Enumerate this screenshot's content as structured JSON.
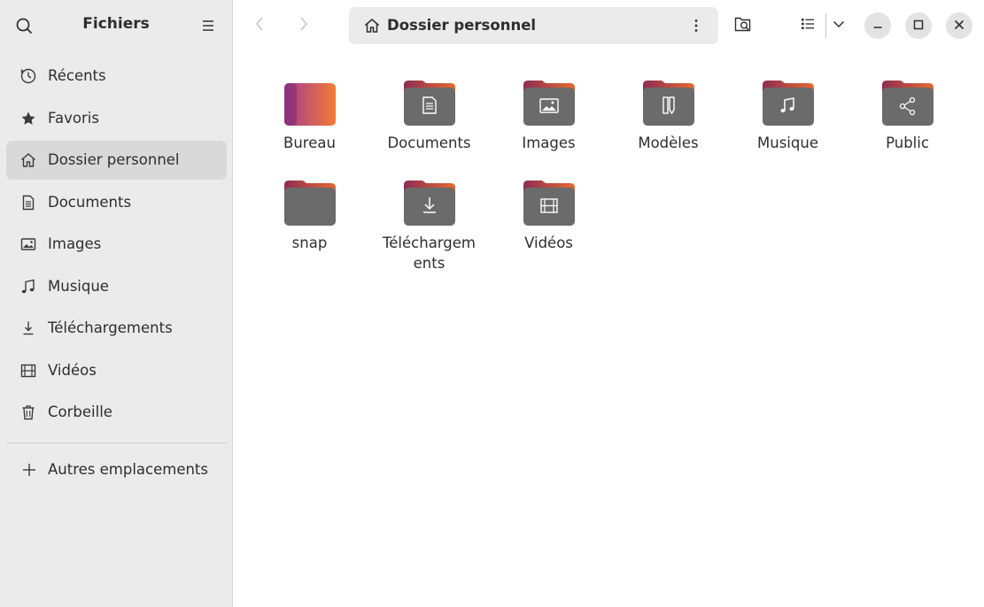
{
  "sidebar": {
    "title": "Fichiers",
    "items": [
      {
        "label": "Récents",
        "icon": "clock-icon"
      },
      {
        "label": "Favoris",
        "icon": "star-icon"
      },
      {
        "label": "Dossier personnel",
        "icon": "home-icon",
        "active": true
      },
      {
        "label": "Documents",
        "icon": "document-icon"
      },
      {
        "label": "Images",
        "icon": "image-icon"
      },
      {
        "label": "Musique",
        "icon": "music-icon"
      },
      {
        "label": "Téléchargements",
        "icon": "download-icon"
      },
      {
        "label": "Vidéos",
        "icon": "film-icon"
      },
      {
        "label": "Corbeille",
        "icon": "trash-icon"
      }
    ],
    "other_locations": "Autres emplacements"
  },
  "header": {
    "path_label": "Dossier personnel"
  },
  "folders": [
    {
      "label": "Bureau",
      "emblem": "desktop"
    },
    {
      "label": "Documents",
      "emblem": "document"
    },
    {
      "label": "Images",
      "emblem": "image"
    },
    {
      "label": "Modèles",
      "emblem": "template"
    },
    {
      "label": "Musique",
      "emblem": "music"
    },
    {
      "label": "Public",
      "emblem": "share"
    },
    {
      "label": "snap",
      "emblem": "none"
    },
    {
      "label": "Téléchargements",
      "emblem": "download"
    },
    {
      "label": "Vidéos",
      "emblem": "film"
    }
  ],
  "colors": {
    "sidebar_bg": "#ebebeb",
    "folder_body": "#6a6a6a",
    "folder_tab_top": "#9c2b4a",
    "folder_tab_bottom": "#e0632f",
    "bureau_grad_start": "#9b3d8e",
    "bureau_grad_end": "#f07e3a"
  }
}
